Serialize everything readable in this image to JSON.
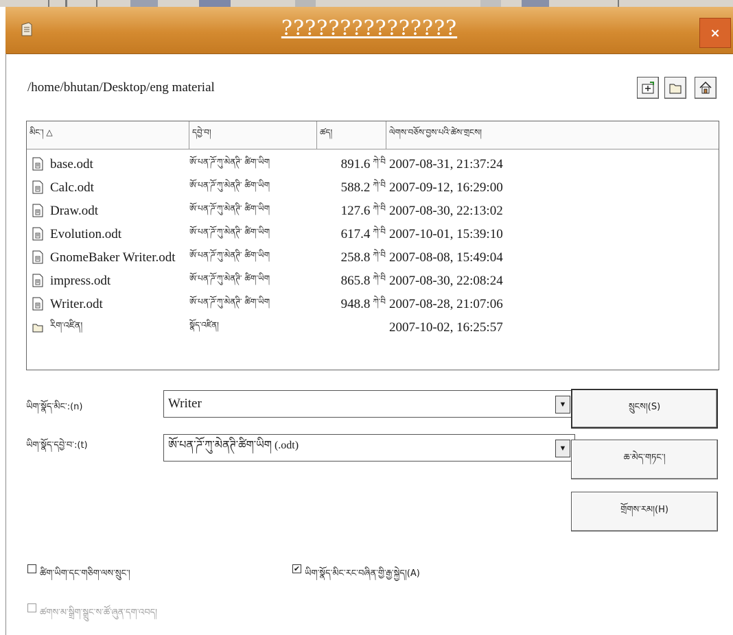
{
  "window": {
    "title": "???????????????",
    "close_label": "×"
  },
  "path": "/home/bhutan/Desktop/eng material",
  "toolbar": {
    "up_icon": "folder-up-icon",
    "new_folder_icon": "new-folder-icon",
    "home_icon": "home-icon"
  },
  "columns": [
    "མིང་། △",
    "དབྱེ་བ།",
    "ཚད།",
    "ལེགས་བཅོས་བྱས་པའི་ཚེས་གྲངས།"
  ],
  "files": [
    {
      "name": "base.odt",
      "type": "ཨོ་པན་ཌོ་ཀུ་མེནཊི་ ཚིག་ཡིག",
      "size": "891.6",
      "unit": "ཀེ་བི",
      "date": "2007-08-31, 21:37:24",
      "icon": "document-icon"
    },
    {
      "name": "Calc.odt",
      "type": "ཨོ་པན་ཌོ་ཀུ་མེནཊི་ ཚིག་ཡིག",
      "size": "588.2",
      "unit": "ཀེ་བི",
      "date": "2007-09-12, 16:29:00",
      "icon": "document-icon"
    },
    {
      "name": "Draw.odt",
      "type": "ཨོ་པན་ཌོ་ཀུ་མེནཊི་ ཚིག་ཡིག",
      "size": "127.6",
      "unit": "ཀེ་བི",
      "date": "2007-08-30, 22:13:02",
      "icon": "document-icon"
    },
    {
      "name": "Evolution.odt",
      "type": "ཨོ་པན་ཌོ་ཀུ་མེནཊི་ ཚིག་ཡིག",
      "size": "617.4",
      "unit": "ཀེ་བི",
      "date": "2007-10-01, 15:39:10",
      "icon": "document-icon"
    },
    {
      "name": "GnomeBaker Writer.odt",
      "type": "ཨོ་པན་ཌོ་ཀུ་མེནཊི་ ཚིག་ཡིག",
      "size": "258.8",
      "unit": "ཀེ་བི",
      "date": "2007-08-08, 15:49:04",
      "icon": "document-icon"
    },
    {
      "name": "impress.odt",
      "type": "ཨོ་པན་ཌོ་ཀུ་མེནཊི་ ཚིག་ཡིག",
      "size": "865.8",
      "unit": "ཀེ་བི",
      "date": "2007-08-30, 22:08:24",
      "icon": "document-icon"
    },
    {
      "name": "Writer.odt",
      "type": "ཨོ་པན་ཌོ་ཀུ་མེནཊི་ ཚིག་ཡིག",
      "size": "948.8",
      "unit": "ཀེ་བི",
      "date": "2007-08-28, 21:07:06",
      "icon": "document-icon"
    },
    {
      "name": "རིག་འཛིན།",
      "type": "སྣོད་འཛིན།",
      "size": "",
      "unit": "",
      "date": "2007-10-02, 16:25:57",
      "icon": "folder-icon"
    }
  ],
  "form": {
    "filename_label": "ཡིག་སྣོད་མིང་:(n)",
    "filename_value": "Writer",
    "filetype_label": "ཡིག་སྣོད་དབྱེ་བ་:(t)",
    "filetype_value": "ཨོ་པན་ཌོ་ཀུ་མེནཊི་ཚིག་ཡིག (.odt)"
  },
  "buttons": {
    "save": "སྲུངས།(S)",
    "cancel": "ཆ་མེད་གཏང་།",
    "help": "གྲོགས་རམ།(H)"
  },
  "checks": {
    "options_label": "ཚིག་ཡིག་དང་གཅིག་ལས་སྲུང་།",
    "options_checked": false,
    "auto_ext_label": "ཡིག་སྣོད་མིང་རང་བཞིན་གྱི་རྒྱ་སྐྱེད།(A)",
    "auto_ext_checked": true,
    "filter_label": "ཚགས་མ་སྒྲིག་སྒྲུང་ས་ཚོ་ཞུན་དག་འབད།",
    "filter_checked": false
  }
}
